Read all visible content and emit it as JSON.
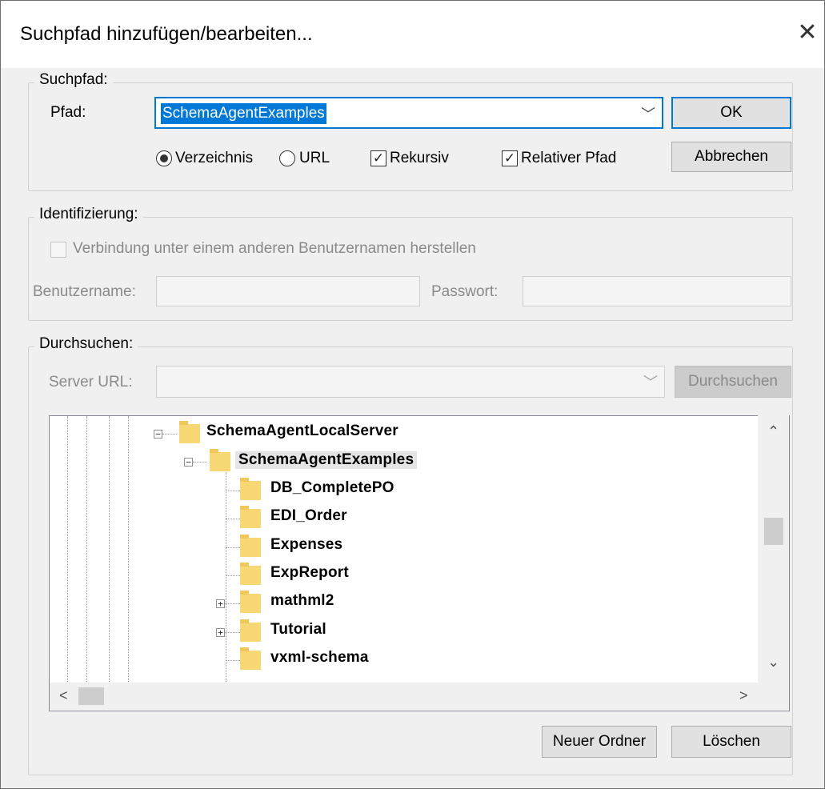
{
  "window": {
    "title": "Suchpfad hinzufügen/bearbeiten...",
    "close_glyph": "✕"
  },
  "search_path": {
    "legend": "Suchpfad:",
    "path_label": "Pfad:",
    "path_value": "SchemaAgentExamples",
    "radio_directory": "Verzeichnis",
    "radio_url": "URL",
    "selected_radio": "Verzeichnis",
    "recursive": "Rekursiv",
    "recursive_checked": true,
    "relative_path": "Relativer Pfad",
    "relative_checked": true,
    "ok": "OK",
    "cancel": "Abbrechen"
  },
  "identification": {
    "legend": "Identifizierung:",
    "connect_other_user": "Verbindung unter einem anderen Benutzernamen herstellen",
    "connect_checked": false,
    "username_label": "Benutzername:",
    "username_value": "",
    "password_label": "Passwort:",
    "password_value": ""
  },
  "browse": {
    "legend": "Durchsuchen:",
    "server_url_label": "Server URL:",
    "server_url_value": "",
    "browse_button": "Durchsuchen",
    "tree": {
      "root": {
        "label": "SchemaAgentLocalServer",
        "expanded": true
      },
      "selected": {
        "label": "SchemaAgentExamples",
        "expanded": true
      },
      "children": [
        {
          "label": "DB_CompletePO",
          "expandable": false
        },
        {
          "label": "EDI_Order",
          "expandable": false
        },
        {
          "label": "Expenses",
          "expandable": false
        },
        {
          "label": "ExpReport",
          "expandable": false
        },
        {
          "label": "mathml2",
          "expandable": true
        },
        {
          "label": "Tutorial",
          "expandable": true
        },
        {
          "label": "vxml-schema",
          "expandable": false
        }
      ]
    },
    "new_folder": "Neuer Ordner",
    "delete": "Löschen"
  },
  "icons": {
    "chevron": "﹀",
    "up": "⌃",
    "down": "⌄",
    "left": "<",
    "right": ">",
    "check": "✓",
    "plus": "+",
    "minus": "−"
  },
  "colors": {
    "accent": "#0078d7",
    "folder": "#f8d775",
    "selection": "#e5e5e5"
  }
}
